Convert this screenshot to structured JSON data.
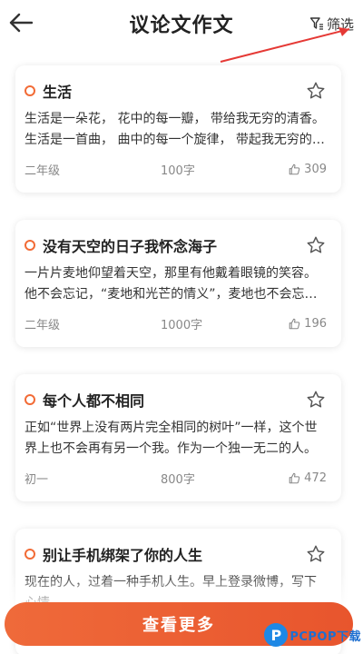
{
  "header": {
    "title": "议论文作文",
    "filter_label": "筛选"
  },
  "essays": [
    {
      "title": "生活",
      "excerpt": "生活是一朵花， 花中的每一瓣， 带给我无穷的清香。 生活是一首曲， 曲中的每一个旋律， 带起我无穷的回忆。",
      "grade": "二年级",
      "words": "100字",
      "likes": "309"
    },
    {
      "title": "没有天空的日子我怀念海子",
      "excerpt": "一片片麦地仰望着天空，那里有他戴着眼镜的笑容。他不会忘记，“麦地和光芒的情义”，麦地也不会忘记他。",
      "grade": "二年级",
      "words": "1000字",
      "likes": "196"
    },
    {
      "title": "每个人都不相同",
      "excerpt": "正如“世界上没有两片完全相同的树叶”一样，这个世界上也不会再有另一个我。作为一个独一无二的人。",
      "grade": "初一",
      "words": "800字",
      "likes": "472"
    },
    {
      "title": "别让手机绑架了你的人生",
      "excerpt": "现在的人，过着一种手机人生。早上登录微博，写下心情。",
      "grade": "",
      "words": "",
      "likes": ""
    }
  ],
  "footer": {
    "more_label": "查看更多"
  },
  "watermark": {
    "logo_letter": "P",
    "text": "PCPOP下载"
  },
  "colors": {
    "accent": "#f26b36",
    "button": "#e95c30",
    "annotation_arrow": "#e53935"
  },
  "icons": [
    "back-arrow-icon",
    "filter-icon",
    "circle-dot-icon",
    "star-outline-icon",
    "thumbs-up-icon"
  ]
}
